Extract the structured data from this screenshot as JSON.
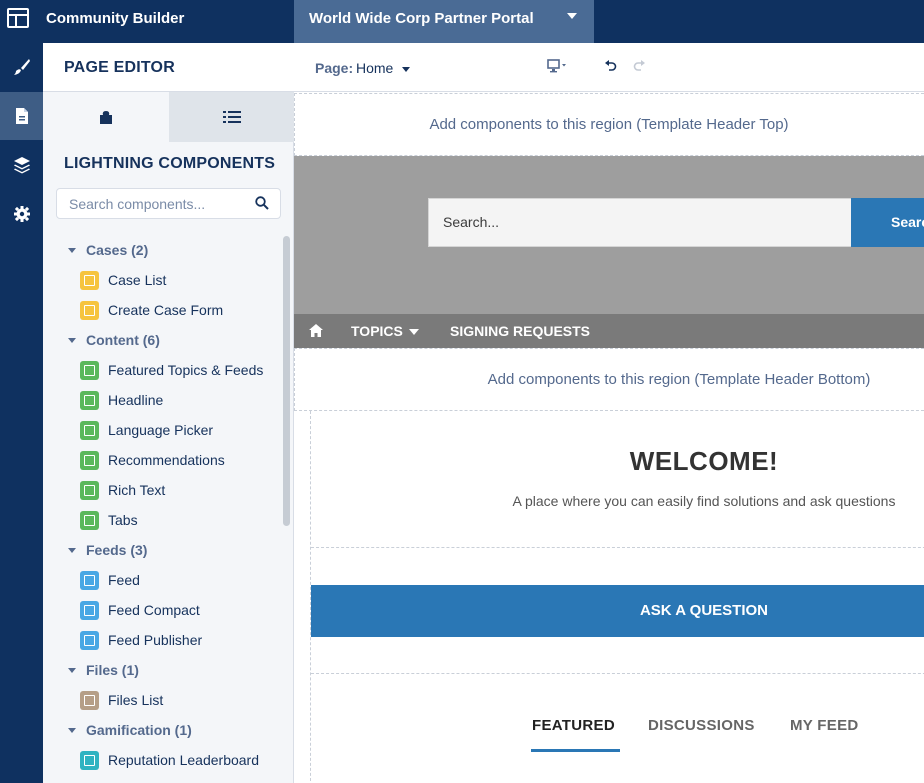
{
  "topbar": {
    "app_title": "Community Builder",
    "site_name": "World Wide Corp Partner Portal"
  },
  "rail": {
    "items": [
      "paintbrush-icon",
      "page-icon",
      "layers-icon",
      "gear-icon"
    ],
    "active": "page-icon"
  },
  "panel": {
    "title": "PAGE EDITOR",
    "section_title": "LIGHTNING COMPONENTS",
    "search_placeholder": "Search components...",
    "groups": [
      {
        "label": "Cases (2)",
        "items": [
          {
            "label": "Case List",
            "color": "yellow"
          },
          {
            "label": "Create Case Form",
            "color": "yellow"
          }
        ]
      },
      {
        "label": "Content (6)",
        "items": [
          {
            "label": "Featured Topics & Feeds",
            "color": "green"
          },
          {
            "label": "Headline",
            "color": "green"
          },
          {
            "label": "Language Picker",
            "color": "green"
          },
          {
            "label": "Recommendations",
            "color": "green"
          },
          {
            "label": "Rich Text",
            "color": "green"
          },
          {
            "label": "Tabs",
            "color": "green"
          }
        ]
      },
      {
        "label": "Feeds (3)",
        "items": [
          {
            "label": "Feed",
            "color": "blue"
          },
          {
            "label": "Feed Compact",
            "color": "blue"
          },
          {
            "label": "Feed Publisher",
            "color": "blue"
          }
        ]
      },
      {
        "label": "Files (1)",
        "items": [
          {
            "label": "Files List",
            "color": "tan"
          }
        ]
      },
      {
        "label": "Gamification (1)",
        "items": [
          {
            "label": "Reputation Leaderboard",
            "color": "teal"
          }
        ]
      }
    ]
  },
  "canvas": {
    "page_label": "Page:",
    "page_value": "Home",
    "region_top": "Add components to this region (Template Header Top)",
    "region_bottom": "Add components to this region (Template Header Bottom)",
    "search_placeholder": "Search...",
    "search_button": "Search",
    "nav": {
      "topics": "TOPICS",
      "signing": "SIGNING REQUESTS"
    },
    "welcome_title": "WELCOME!",
    "welcome_sub": "A place where you can easily find solutions and ask questions",
    "ask_button": "ASK A QUESTION",
    "tabs": [
      "FEATURED",
      "DISCUSSIONS",
      "MY FEED"
    ],
    "active_tab": "FEATURED"
  },
  "colors": {
    "topbar": "#0f3160",
    "site_switcher": "#4a6b95",
    "brand_blue": "#2a77b5",
    "hero_gray": "#9e9e9e",
    "nav_gray": "#7a7a7a"
  }
}
